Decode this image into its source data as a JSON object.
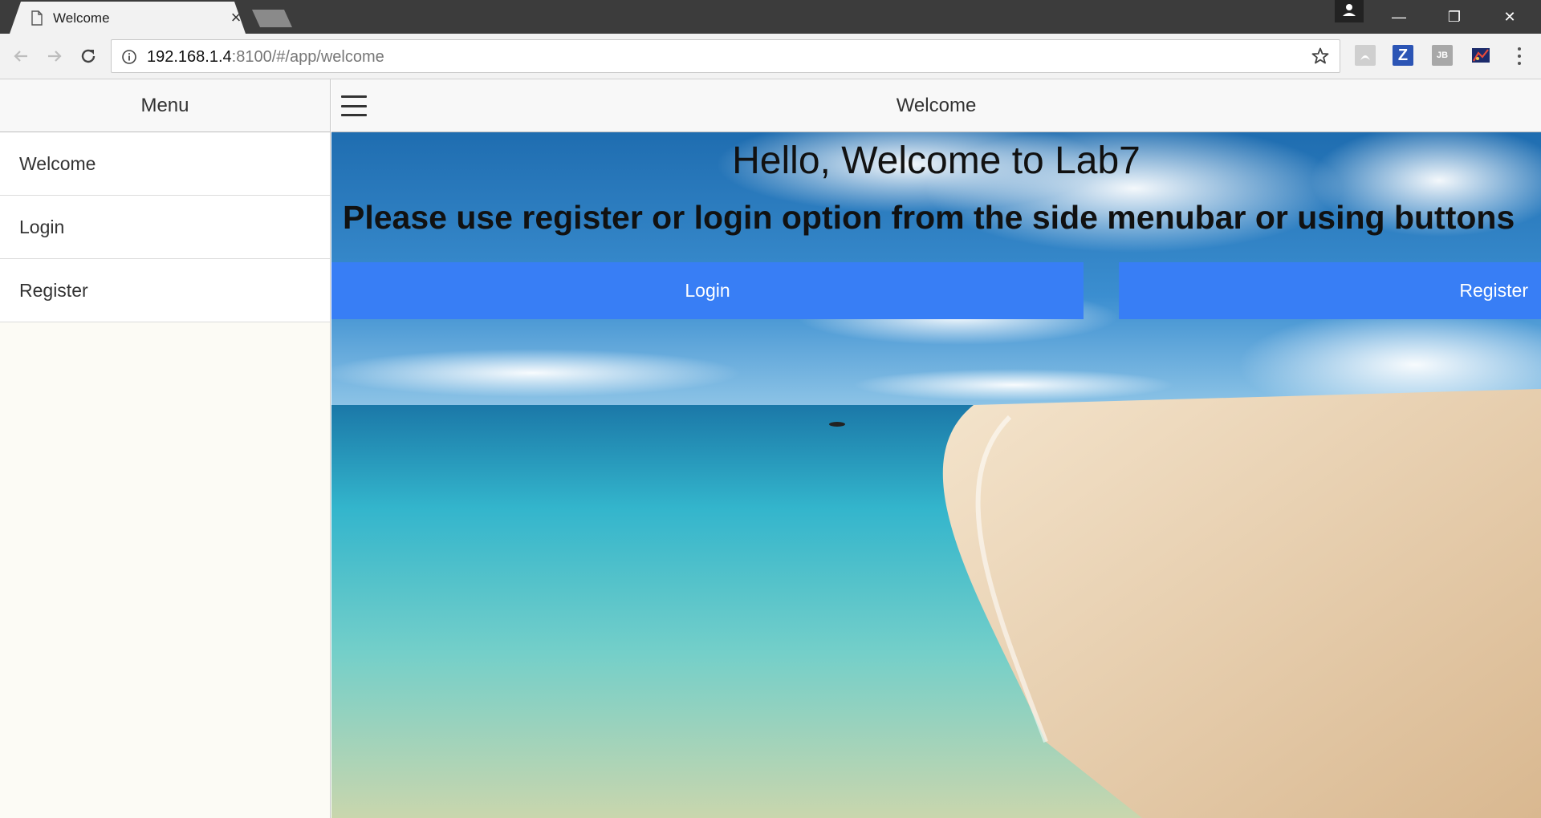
{
  "browser": {
    "tab_title": "Welcome",
    "tab_close": "×",
    "url_host": "192.168.1.4",
    "url_rest": ":8100/#/app/welcome",
    "window_controls": {
      "minimize": "—",
      "restore": "❐",
      "close": "✕"
    },
    "extensions": {
      "z_label": "Z",
      "jb_label": "JB"
    }
  },
  "side_menu": {
    "title": "Menu",
    "items": [
      {
        "label": "Welcome"
      },
      {
        "label": "Login"
      },
      {
        "label": "Register"
      }
    ]
  },
  "header": {
    "title": "Welcome"
  },
  "content": {
    "heading": "Hello, Welcome to Lab7",
    "instruction": "Please use register or login option from the side menubar or using buttons",
    "login_button": "Login",
    "register_button": "Register"
  },
  "colors": {
    "accent": "#387ef5",
    "titlebar": "#3c3c3c",
    "sky": "#2a7fc3",
    "sea": "#3fb8cf",
    "sand": "#ecd3b3"
  },
  "icons": {
    "tab": "page-icon",
    "back": "arrow-left-icon",
    "forward": "arrow-right-icon",
    "reload": "reload-icon",
    "info": "info-icon",
    "bookmark": "star-icon",
    "menu": "hamburger-icon",
    "browser_menu": "kebab-menu-icon"
  }
}
